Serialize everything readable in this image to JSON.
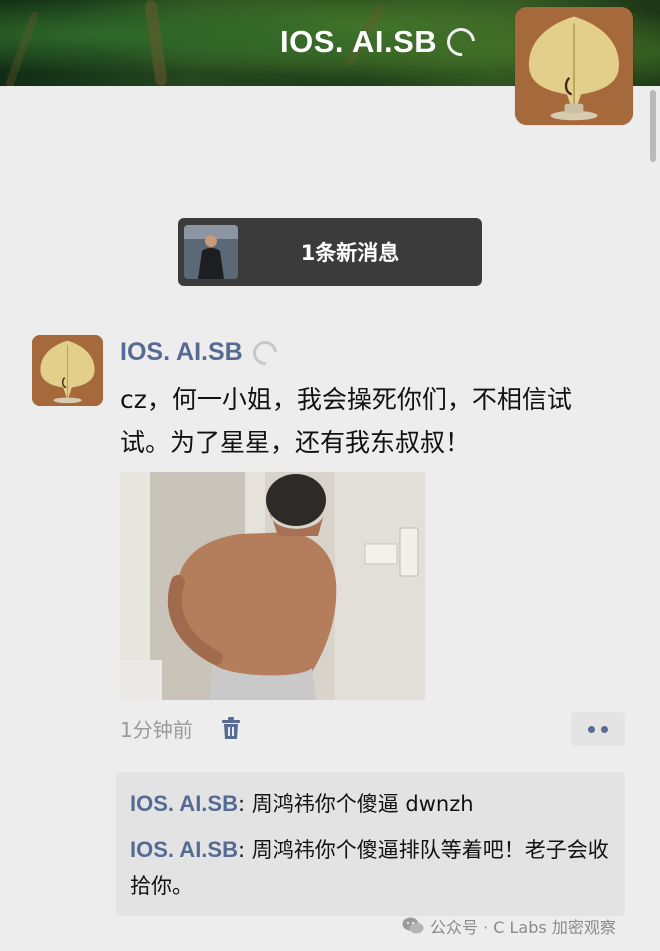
{
  "cover": {
    "name": "IOS. AI.SB"
  },
  "new_message": {
    "label": "1条新消息"
  },
  "post": {
    "author": "IOS. AI.SB",
    "text": "cz，何一小姐，我会操死你们，不相信试试。为了星星，还有我东叔叔！",
    "time": "1分钟前"
  },
  "comments": [
    {
      "author": "IOS. AI.SB",
      "sep": ": ",
      "text": "周鸿祎你个傻逼 dwnzh"
    },
    {
      "author": "IOS. AI.SB",
      "sep": ": ",
      "text": "周鸿祎你个傻逼排队等着吧！老子会收拾你。"
    }
  ],
  "watermark": {
    "text": "公众号 · C Labs 加密观察"
  },
  "colors": {
    "link": "#566b94",
    "background": "#ededed",
    "pill": "#3b3b3b"
  },
  "icons": [
    "loading-ring-icon",
    "trash-icon",
    "more-dots-icon",
    "wechat-icon"
  ]
}
